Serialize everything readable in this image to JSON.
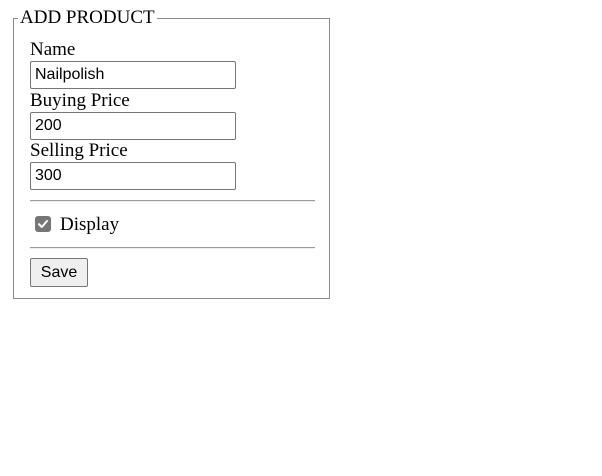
{
  "form": {
    "legend": "ADD PRODUCT",
    "fields": [
      {
        "label": "Name",
        "value": "Nailpolish"
      },
      {
        "label": "Buying Price",
        "value": "200"
      },
      {
        "label": "Selling Price",
        "value": "300"
      }
    ],
    "display_checkbox": {
      "label": "Display",
      "checked": true
    },
    "save_label": "Save"
  },
  "colors": {
    "border": "#8a8a8a",
    "checkbox_fill": "#767676",
    "button_bg": "#efefef"
  }
}
